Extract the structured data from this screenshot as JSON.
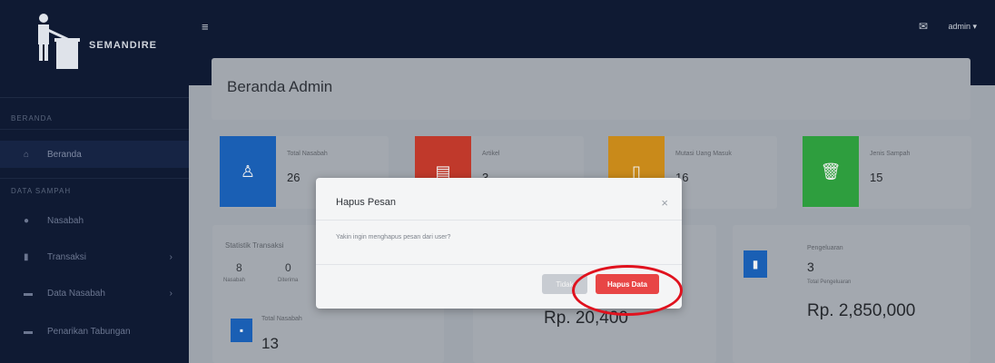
{
  "brand": {
    "name": "SEMANDIRE"
  },
  "sidebar": {
    "heading_main": "BERANDA",
    "heading_data": "DATA SAMPAH",
    "items": [
      {
        "label": "Beranda",
        "icon": "home-icon"
      },
      {
        "label": "Nasabah",
        "icon": "users-icon"
      },
      {
        "label": "Transaksi",
        "icon": "transaction-icon"
      },
      {
        "label": "Data Nasabah",
        "icon": "database-icon"
      },
      {
        "label": "Penarikan Tabungan",
        "icon": "money-icon"
      }
    ]
  },
  "topbar": {
    "user": "admin ▾"
  },
  "page": {
    "title": "Beranda Admin"
  },
  "stats": [
    {
      "label": "Total Nasabah",
      "value": "26",
      "color": "#1a5fb4",
      "icon": "user-icon"
    },
    {
      "label": "Artikel",
      "value": "3",
      "color": "#c0392b",
      "icon": "article-icon"
    },
    {
      "label": "Mutasi Uang Masuk",
      "value": "16",
      "color": "#c98a1a",
      "icon": "document-icon"
    },
    {
      "label": "Jenis Sampah",
      "value": "15",
      "color": "#2e9e3e",
      "icon": "trash-icon"
    }
  ],
  "lower": {
    "panel_title": "Statistik Transaksi",
    "counts": [
      {
        "value": "8",
        "label": "Nasabah"
      },
      {
        "value": "0",
        "label": "Diterima"
      }
    ],
    "total_label": "Total Nasabah",
    "total_value": "13",
    "middle_amount": "Rp. 20,400",
    "right_title": "Pengeluaran",
    "right_value": "3",
    "right_sublabel": "Total Pengeluaran",
    "right_amount": "Rp. 2,850,000"
  },
  "modal": {
    "title": "Hapus Pesan",
    "body": "Yakin ingin menghapus pesan dari user?",
    "cancel_label": "Tidak",
    "confirm_label": "Hapus Data",
    "confirm_color": "#e84545"
  },
  "annotation": {
    "color": "#e0121e"
  }
}
